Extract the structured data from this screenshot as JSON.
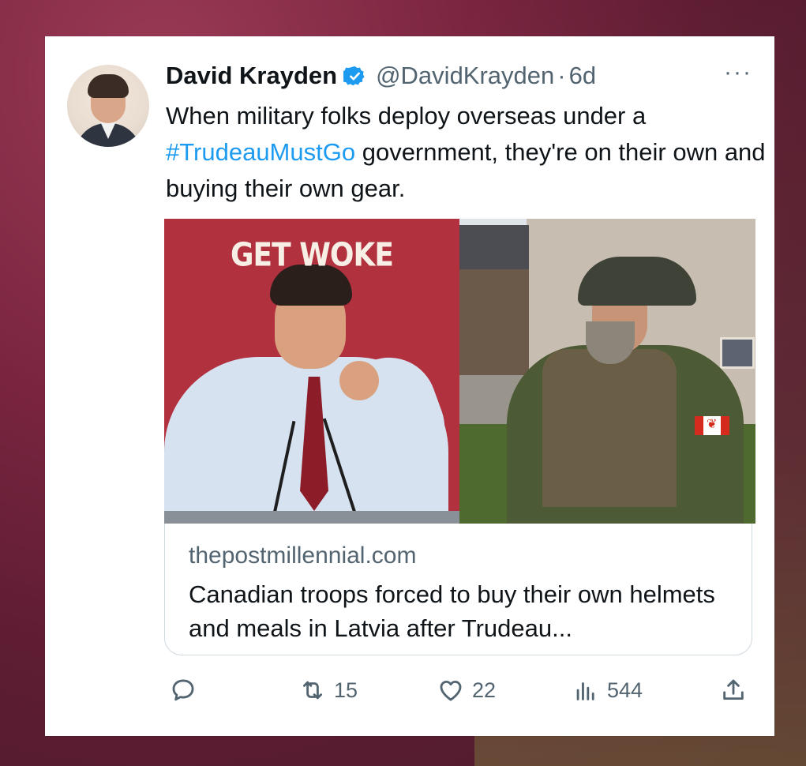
{
  "tweet": {
    "author_name": "David Krayden",
    "handle": "@DavidKrayden",
    "separator": "·",
    "time": "6d",
    "more_label": "···",
    "text_part1": "When military folks deploy overseas under a ",
    "hashtag": "#TrudeauMustGo",
    "text_part2": " government, they're on their own and buying their own gear.",
    "image_caption": "GET WOKE"
  },
  "link_card": {
    "domain": "thepostmillennial.com",
    "title": "Canadian troops forced to buy their own helmets and meals in Latvia after Trudeau..."
  },
  "actions": {
    "reply_count": "",
    "retweet_count": "15",
    "like_count": "22",
    "views_count": "544"
  },
  "colors": {
    "accent": "#1d9bf0",
    "text": "#0f1419",
    "secondary": "#536471"
  },
  "icons": [
    "verified-badge-icon",
    "more-icon",
    "reply-icon",
    "retweet-icon",
    "like-icon",
    "views-icon",
    "share-icon"
  ]
}
